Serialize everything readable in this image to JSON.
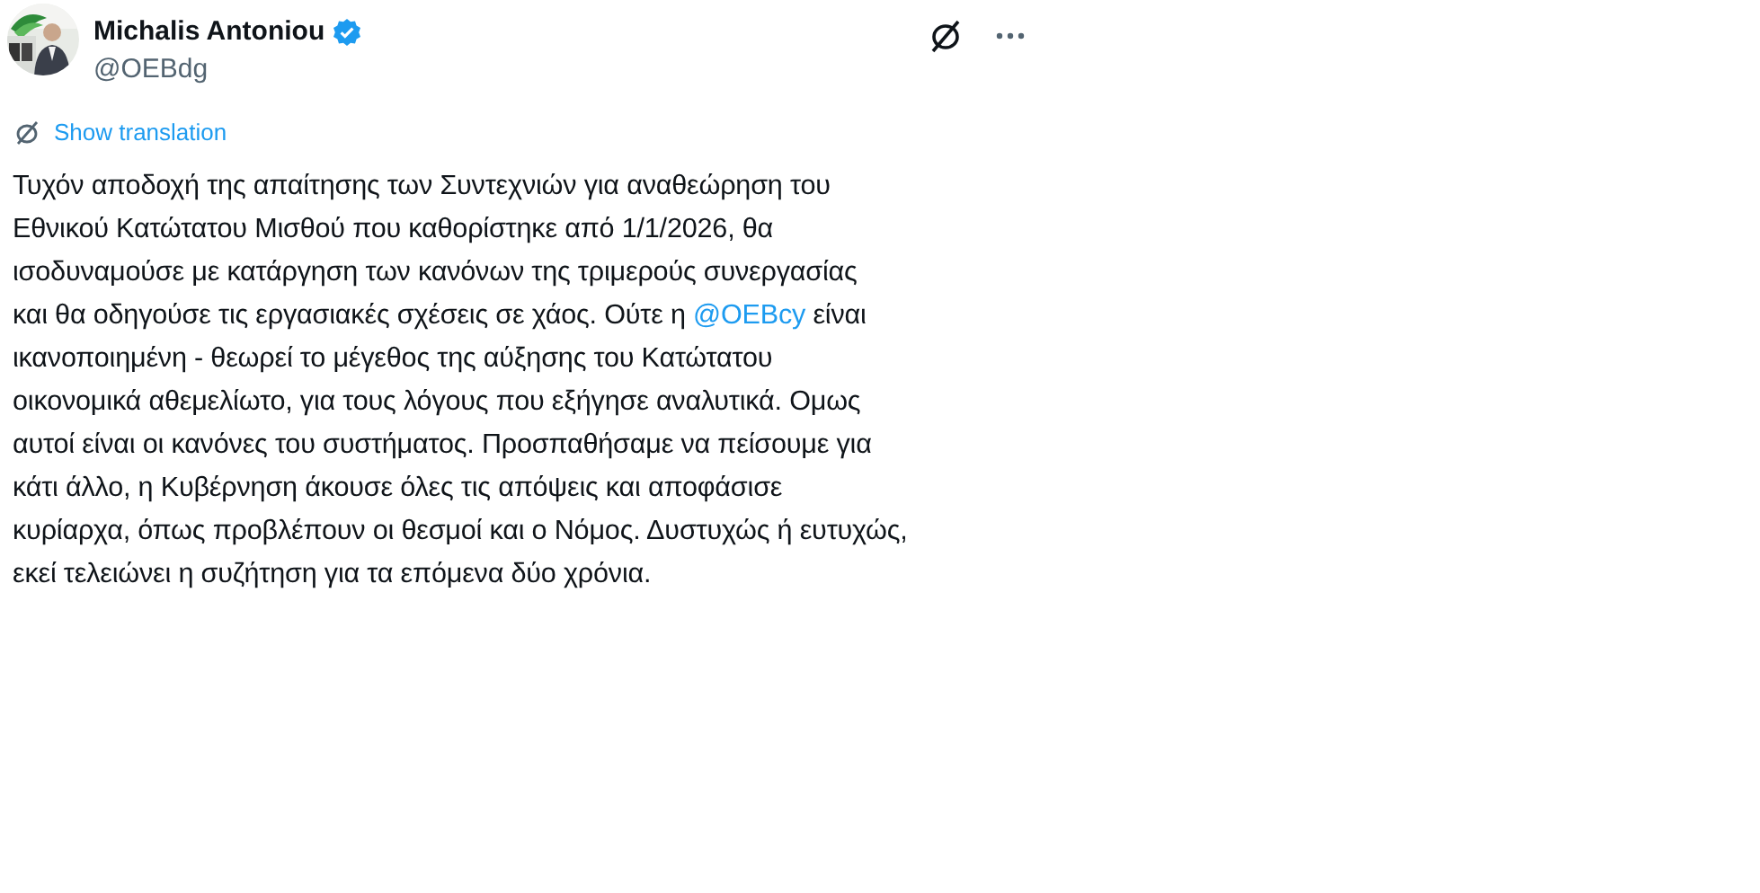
{
  "author": {
    "name": "Michalis Antoniou",
    "verified": true,
    "handle": "@OEBdg"
  },
  "header_actions": [
    {
      "kind": "grok"
    },
    {
      "kind": "more"
    }
  ],
  "translation_link": "Show translation",
  "body_lines": [
    [
      {
        "kind": "text",
        "text": "Τυχόν αποδοχή της απαίτησης των Συντεχνιών για αναθεώρηση του"
      }
    ],
    [
      {
        "kind": "text",
        "text": "Εθνικού Κατώτατου Μισθού που καθορίστηκε από 1/1/2026, θα"
      }
    ],
    [
      {
        "kind": "text",
        "text": "ισοδυναμούσε με κατάργηση των κανόνων της τριμερούς συνεργασίας"
      }
    ],
    [
      {
        "kind": "text",
        "text": "και θα οδηγούσε τις εργασιακές σχέσεις σε χάος. Ούτε η "
      },
      {
        "kind": "mention",
        "text": "@OEBcy"
      },
      {
        "kind": "text",
        "text": " είναι"
      }
    ],
    [
      {
        "kind": "text",
        "text": "ικανοποιημένη - θεωρεί το μέγεθος της αύξησης του Κατώτατου"
      }
    ],
    [
      {
        "kind": "text",
        "text": "οικονομικά αθεμελίωτο, για τους λόγους που εξήγησε αναλυτικά. Ομως"
      }
    ],
    [
      {
        "kind": "text",
        "text": "αυτοί είναι οι κανόνες του συστήματος.  Προσπαθήσαμε να πείσουμε για"
      }
    ],
    [
      {
        "kind": "text",
        "text": "κάτι άλλο, η Κυβέρνηση άκουσε όλες τις απόψεις και αποφάσισε"
      }
    ],
    [
      {
        "kind": "text",
        "text": "κυρίαρχα, όπως προβλέπουν οι θεσμοί και ο Νόμος. Δυστυχώς ή ευτυχώς,"
      }
    ],
    [
      {
        "kind": "text",
        "text": "εκεί τελειώνει η συζήτηση για τα επόμενα δύο χρόνια."
      }
    ]
  ]
}
